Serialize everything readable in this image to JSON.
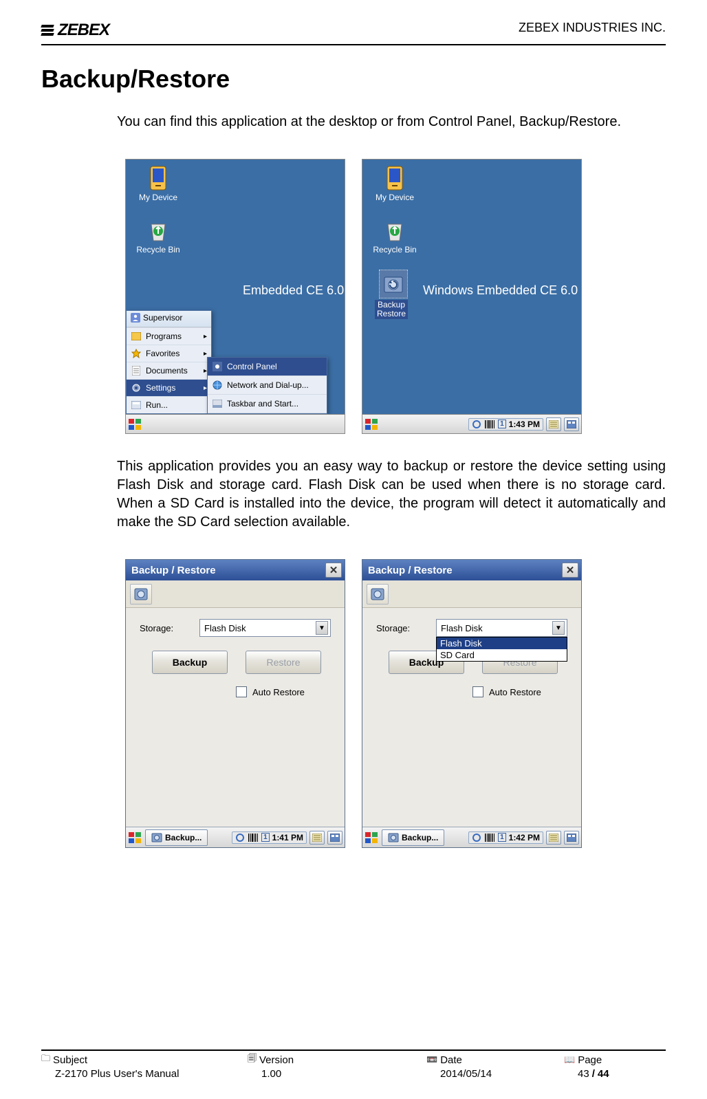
{
  "header": {
    "brand": "ZEBEX",
    "company": "ZEBEX INDUSTRIES INC."
  },
  "doc": {
    "title": "Backup/Restore",
    "p1": "You can find this application at the desktop or from Control Panel, Backup/Restore.",
    "p2": "This application provides you an easy way to backup or restore the device setting using Flash Disk and storage card. Flash Disk can be used when there is no storage card. When a SD Card is installed into the device, the program will detect it automatically and make the SD Card selection available."
  },
  "ce1": {
    "my_device": "My Device",
    "recycle": "Recycle Bin",
    "os_text": "Embedded CE 6.0",
    "start": {
      "header": "Supervisor",
      "items": [
        {
          "label": "Programs"
        },
        {
          "label": "Favorites"
        },
        {
          "label": "Documents"
        },
        {
          "label": "Settings"
        },
        {
          "label": "Run..."
        }
      ],
      "sub": {
        "items": [
          {
            "label": "Control Panel"
          },
          {
            "label": "Network and Dial-up..."
          },
          {
            "label": "Taskbar and Start..."
          }
        ]
      }
    }
  },
  "ce2": {
    "my_device": "My Device",
    "recycle": "Recycle Bin",
    "os_text": "Windows Embedded CE 6.0",
    "shortcut_label": "Backup\nRestore",
    "taskbar_time": "1:43 PM"
  },
  "br1": {
    "title": "Backup / Restore",
    "storage_label": "Storage:",
    "storage_value": "Flash Disk",
    "backup_btn": "Backup",
    "restore_btn": "Restore",
    "auto_restore": "Auto Restore",
    "task_app": "Backup...",
    "time": "1:41 PM"
  },
  "br2": {
    "title": "Backup / Restore",
    "storage_label": "Storage:",
    "storage_value": "Flash Disk",
    "options": [
      "Flash Disk",
      "SD Card"
    ],
    "backup_btn": "Backup",
    "restore_btn": "Restore",
    "auto_restore": "Auto Restore",
    "task_app": "Backup...",
    "time": "1:42 PM"
  },
  "footer": {
    "labels": {
      "subject": "Subject",
      "version": "Version",
      "date": "Date",
      "page": "Page"
    },
    "values": {
      "subject": "Z-2170 Plus User's Manual",
      "version": "1.00",
      "date": "2014/05/14",
      "page_cur": "43",
      "page_sep": " / ",
      "page_total": "44"
    }
  }
}
